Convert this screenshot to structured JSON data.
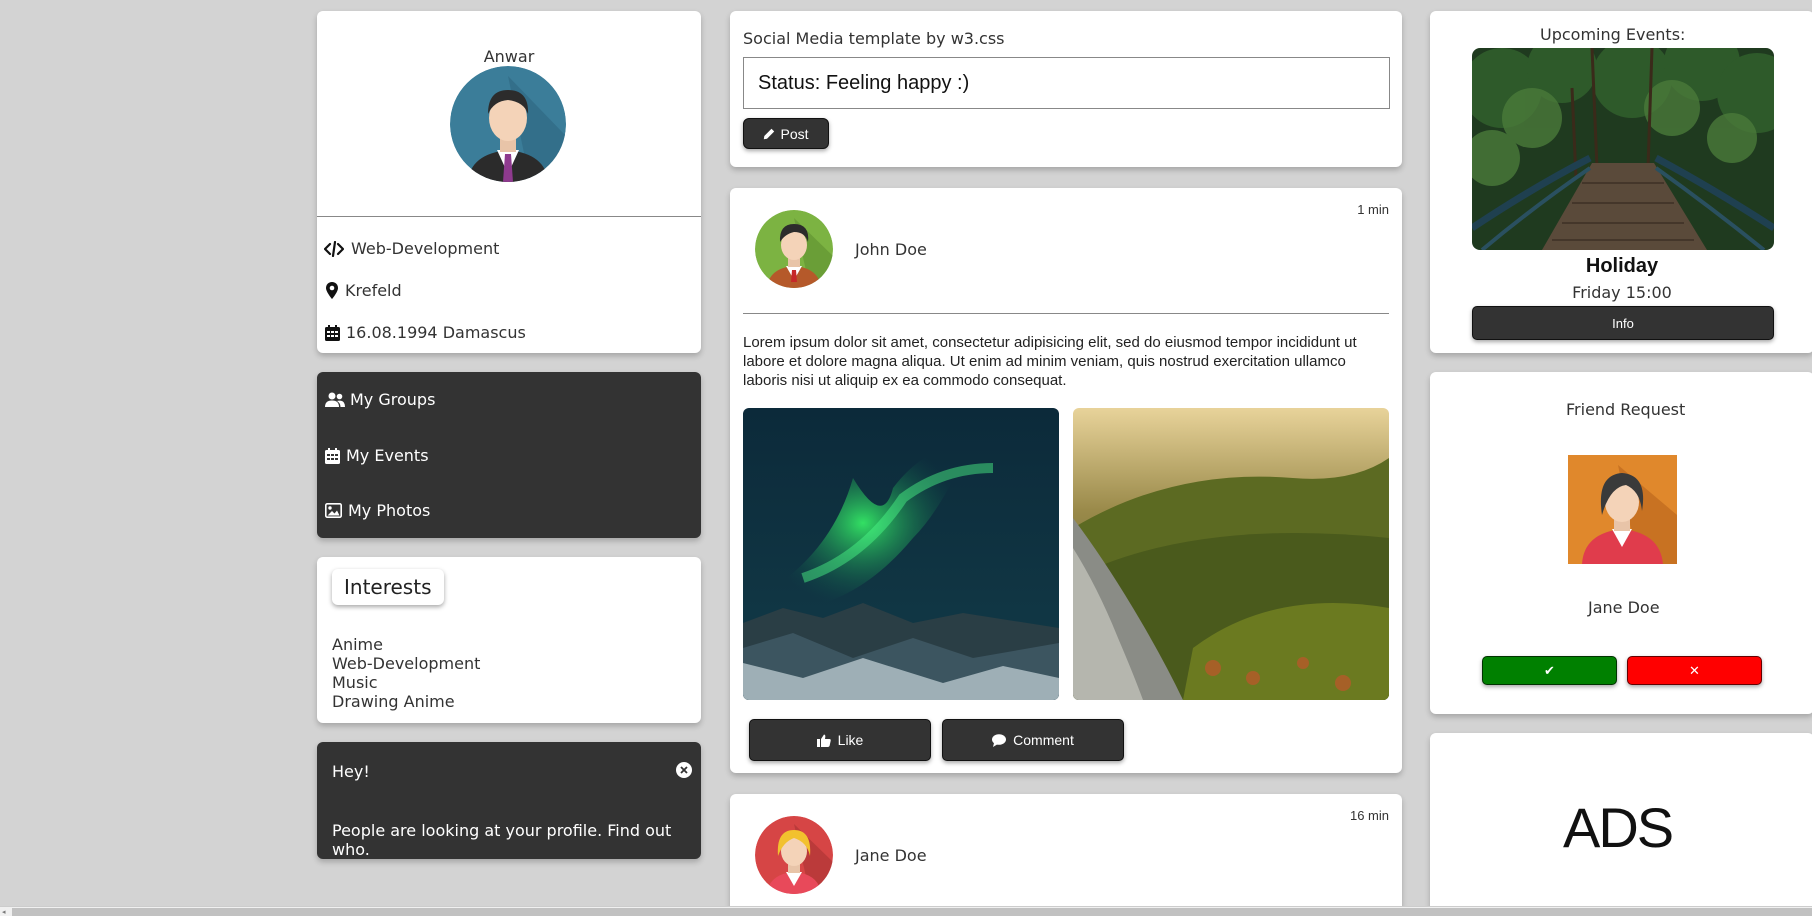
{
  "profile": {
    "name": "Anwar",
    "details": [
      {
        "icon": "code-icon",
        "text": "Web-Development"
      },
      {
        "icon": "map-pin-icon",
        "text": "Krefeld"
      },
      {
        "icon": "calendar-icon",
        "text": "16.08.1994 Damascus"
      }
    ]
  },
  "nav": {
    "items": [
      {
        "icon": "users-icon",
        "label": "My Groups"
      },
      {
        "icon": "calendar-icon",
        "label": "My Events"
      },
      {
        "icon": "image-icon",
        "label": "My Photos"
      }
    ]
  },
  "interests": {
    "title": "Interests",
    "items": [
      "Anime",
      "Web-Development",
      "Music",
      "Drawing Anime"
    ]
  },
  "alert": {
    "title": "Hey!",
    "message": "People are looking at your profile. Find out who."
  },
  "composer": {
    "heading": "Social Media template by w3.css",
    "status_value": "Status: Feeling happy :)",
    "post_label": "Post"
  },
  "posts": [
    {
      "author": "John Doe",
      "time": "1 min",
      "text": "Lorem ipsum dolor sit amet, consectetur adipisicing elit, sed do eiusmod tempor incididunt ut labore et dolore magna aliqua. Ut enim ad minim veniam, quis nostrud exercitation ullamco laboris nisi ut aliquip ex ea commodo consequat.",
      "like_label": "Like",
      "comment_label": "Comment"
    },
    {
      "author": "Jane Doe",
      "time": "16 min"
    }
  ],
  "events": {
    "heading": "Upcoming Events:",
    "title": "Holiday",
    "time": "Friday 15:00",
    "info_label": "Info"
  },
  "friend_request": {
    "heading": "Friend Request",
    "name": "Jane Doe",
    "accept_label": "✔",
    "decline_label": "✕"
  },
  "ads": {
    "text": "ADS"
  },
  "colors": {
    "dark": "#333333",
    "accept": "#008000",
    "decline": "#ff0000",
    "background": "#d3d3d3"
  }
}
